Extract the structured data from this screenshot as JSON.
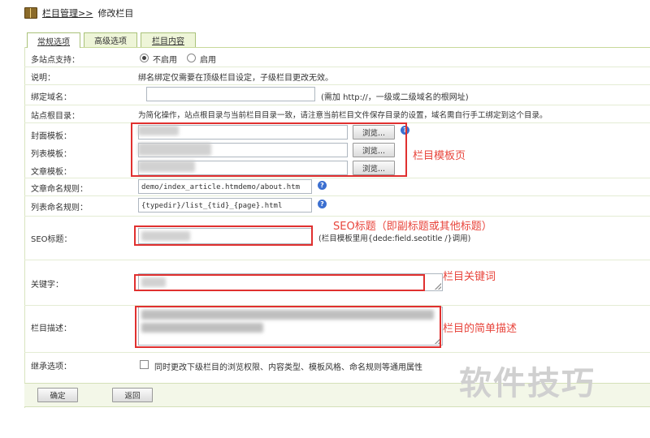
{
  "breadcrumb": {
    "section": "栏目管理>>",
    "current": "修改栏目"
  },
  "tabs": [
    {
      "label": "常规选项",
      "active": true
    },
    {
      "label": "高级选项",
      "active": false
    },
    {
      "label": "栏目内容",
      "active": false
    }
  ],
  "rows": {
    "multisite": {
      "label": "多站点支持：",
      "options": [
        "不启用",
        "启用"
      ],
      "selected": "不启用"
    },
    "explain": {
      "label": "说明：",
      "text": "绑名绑定仅需要在顶级栏目设定，子级栏目更改无效。"
    },
    "domain": {
      "label": "绑定域名：",
      "value": "",
      "hint": "(需加 http://，一级或二级域名的根网址)"
    },
    "siteroot": {
      "label": "站点根目录：",
      "text": "为简化操作，站点根目录与当前栏目目录一致，请注意当前栏目文件保存目录的设置，域名需自行手工绑定到这个目录。"
    },
    "cover_template": {
      "label": "封面模板：",
      "button": "浏览..."
    },
    "list_template": {
      "label": "列表模板：",
      "button": "浏览..."
    },
    "article_template": {
      "label": "文章模板：",
      "button": "浏览..."
    },
    "article_naming": {
      "label": "文章命名规则：",
      "value": "demo/index_article.htmdemo/about.htm"
    },
    "list_naming": {
      "label": "列表命名规则：",
      "value": "{typedir}/list_{tid}_{page}.html"
    },
    "seo_title": {
      "label": "SEO标题：",
      "hint": "(栏目模板里用{dede:field.seotitle /}调用)"
    },
    "keywords": {
      "label": "关键字："
    },
    "description": {
      "label": "栏目描述："
    },
    "inherit": {
      "label": "继承选项：",
      "text": "同时更改下级栏目的浏览权限、内容类型、模板风格、命名规则等通用属性",
      "checked": false
    }
  },
  "buttons": {
    "confirm": "确定",
    "back": "返回"
  },
  "annotations": {
    "templates": "栏目模板页",
    "seo": "SEO标题（即副标题或其他标题）",
    "keywords": "栏目关键词",
    "description": "栏目的简单描述"
  },
  "watermark": "软件技巧",
  "colors": {
    "annotation_red": "#e0302f",
    "tab_green": "#aac27a",
    "help_blue": "#3b6fd0"
  }
}
